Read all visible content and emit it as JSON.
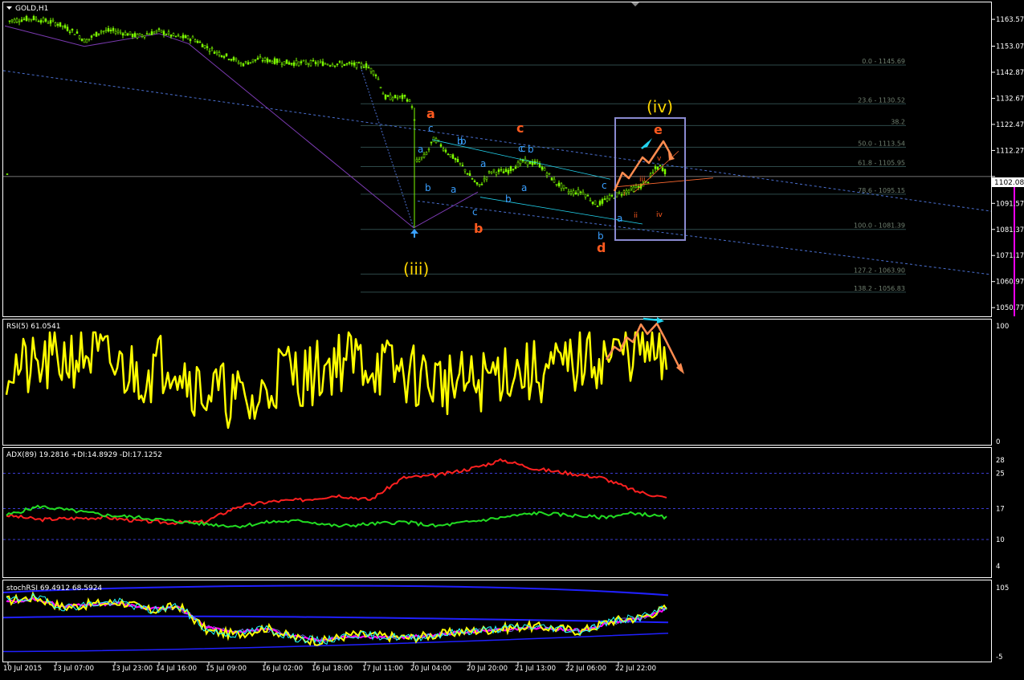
{
  "colors": {
    "background": "#000000",
    "grid": "#ffffff",
    "candle_up": "#7cfc00",
    "fib_line": "#2e4a4a",
    "fib_text": "#708070",
    "trend_dash": "#4a6fd0",
    "cyan": "#22d3ee",
    "orange_label": "#ff5a1f",
    "blue_label": "#3aa0ff",
    "yellow_label": "#ffd700",
    "box": "#8a8ad0",
    "rsi_line": "#ffff00",
    "adx_red": "#ff2020",
    "adx_green": "#22dd22",
    "stoch_blue": "#2020ff",
    "stoch_yellow": "#ffff00",
    "stoch_magenta": "#ff00ff",
    "stoch_cyan": "#20ffff",
    "stoch_lightblue": "#8080ff",
    "orange_arrow": "#ff8c50",
    "pink_bar": "#ff00ff"
  },
  "main": {
    "title": "GOLD,H1",
    "current_price": "1102.08",
    "price_ticks": [
      "1163.57",
      "1153.07",
      "1142.87",
      "1132.67",
      "1122.47",
      "1112.27",
      "1102.08",
      "1091.57",
      "1081.37",
      "1071.17",
      "1060.97",
      "1050.77"
    ],
    "fib_levels": [
      "0.0 - 1145.69",
      "23.6 - 1130.52",
      "38.2",
      "50.0 - 1113.54",
      "61.8 - 1105.95",
      "78.6 - 1095.15",
      "100.0 - 1081.39",
      "127.2 - 1063.90",
      "138.2 - 1056.83"
    ],
    "wave_labels": {
      "iii": "(iii)",
      "iv": "(iv)",
      "a": "a",
      "b": "b",
      "c": "c",
      "d": "d",
      "e": "e",
      "sub": [
        "c",
        "a",
        "b",
        "a",
        "b",
        "c",
        "a",
        "a",
        "b",
        "c",
        "b",
        "c",
        "a",
        "b",
        "c",
        "b"
      ],
      "roman": [
        "i",
        "ii",
        "iii",
        "iv",
        "v"
      ]
    }
  },
  "rsi": {
    "label": "RSI(5) 61.0541",
    "ticks": [
      "100",
      "0"
    ]
  },
  "adx": {
    "label": "ADX(89) 19.2816 +DI:14.8929 -DI:17.1252",
    "ticks": [
      "28",
      "25",
      "17",
      "10",
      "4"
    ]
  },
  "stoch": {
    "label": "stochRSI 69.4912 68.5924",
    "ticks": [
      "105",
      "-5"
    ]
  },
  "time_axis": [
    "10 Jul 2015",
    "13 Jul 07:00",
    "13 Jul 23:00",
    "14 Jul 16:00",
    "15 Jul 09:00",
    "16 Jul 02:00",
    "16 Jul 18:00",
    "17 Jul 11:00",
    "20 Jul 04:00",
    "20 Jul 20:00",
    "21 Jul 13:00",
    "22 Jul 06:00",
    "22 Jul 22:00"
  ],
  "chart_data": [
    {
      "type": "candlestick",
      "title": "GOLD,H1",
      "ylim": [
        1048.0,
        1168.0
      ],
      "anchor_points": [
        {
          "x": "10 Jul 2015",
          "y": 1163.0
        },
        {
          "x": "13 Jul 07:00",
          "y": 1158.5
        },
        {
          "x": "13 Jul 23:00",
          "y": 1156.5
        },
        {
          "x": "14 Jul 16:00",
          "y": 1154.5
        },
        {
          "x": "15 Jul 09:00",
          "y": 1148.5
        },
        {
          "x": "16 Jul 02:00",
          "y": 1146.5
        },
        {
          "x": "16 Jul 18:00",
          "y": 1146.2
        },
        {
          "x": "17 Jul 11:00",
          "y": 1132.0
        },
        {
          "x": "20 Jul 04:00",
          "y": 1107.0
        },
        {
          "x": "20 Jul 20:00",
          "y": 1101.0
        },
        {
          "x": "21 Jul 13:00",
          "y": 1102.0
        },
        {
          "x": "22 Jul 06:00",
          "y": 1091.5
        },
        {
          "x": "22 Jul 22:00",
          "y": 1103.5
        }
      ],
      "current": 1102.08
    },
    {
      "type": "line",
      "title": "RSI(5) 61.0541",
      "ylim": [
        0,
        100
      ],
      "series": [
        {
          "name": "RSI(5)",
          "values": [
            65,
            60,
            70,
            75,
            62,
            58,
            72,
            45,
            40,
            30,
            62,
            55,
            70,
            68,
            60,
            55,
            50,
            48,
            62,
            58,
            60,
            70,
            72,
            80,
            61
          ]
        }
      ]
    },
    {
      "type": "line",
      "title": "ADX(89) 19.2816 +DI:14.8929 -DI:17.1252",
      "ylim": [
        4,
        28
      ],
      "series": [
        {
          "name": "ADX",
          "values": [
            15.5,
            14.5,
            14.8,
            15.0,
            14.2,
            13.8,
            14.0,
            17.5,
            18.6,
            19.0,
            20.0,
            19.0,
            24.0,
            24.5,
            26.0,
            28.0,
            26.0,
            25.0,
            24.0,
            21.0,
            19.28
          ]
        },
        {
          "name": "+DI",
          "values": [
            15.5,
            17.5,
            16.5,
            15.5,
            15.0,
            14.2,
            13.5,
            13.0,
            14.0,
            14.2,
            13.0,
            13.5,
            14.0,
            13.0,
            14.0,
            15.0,
            16.0,
            15.5,
            15.0,
            16.0,
            14.89
          ]
        }
      ]
    },
    {
      "type": "line",
      "title": "stochRSI 69.4912 68.5924",
      "ylim": [
        -5,
        105
      ],
      "series": [
        {
          "name": "stochRSI",
          "values": [
            80,
            85,
            70,
            75,
            78,
            65,
            72,
            35,
            30,
            40,
            25,
            20,
            30,
            28,
            25,
            30,
            35,
            38,
            42,
            40,
            35,
            50,
            55,
            69.49
          ]
        },
        {
          "name": "signal",
          "values": [
            78,
            82,
            72,
            74,
            76,
            68,
            70,
            40,
            34,
            38,
            28,
            22,
            28,
            26,
            26,
            30,
            34,
            36,
            40,
            38,
            36,
            48,
            53,
            68.59
          ]
        }
      ]
    }
  ]
}
